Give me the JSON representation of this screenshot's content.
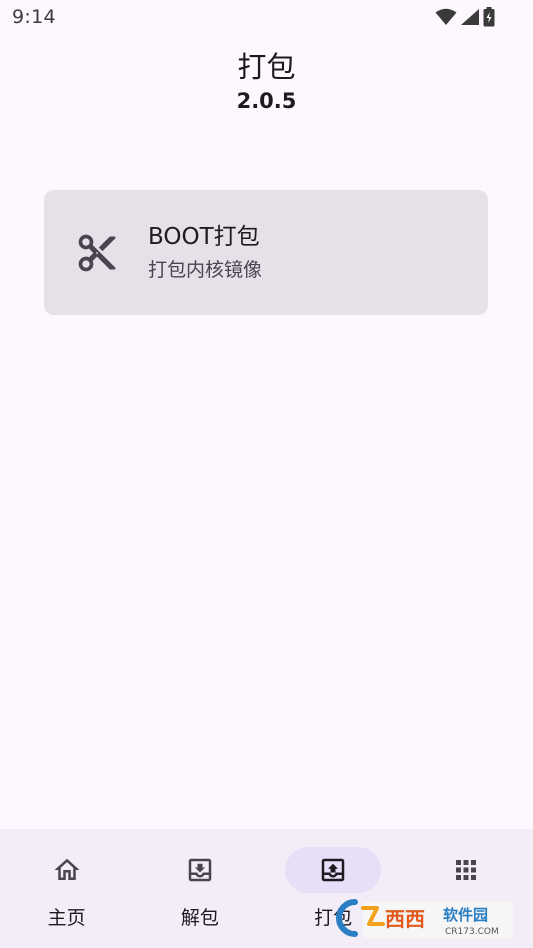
{
  "status_bar": {
    "time": "9:14",
    "icons": [
      "wifi-icon",
      "signal-icon",
      "battery-charging-icon"
    ]
  },
  "header": {
    "title": "打包",
    "version": "2.0.5"
  },
  "cards": [
    {
      "icon": "scissors-icon",
      "title": "BOOT打包",
      "subtitle": "打包内核镜像"
    }
  ],
  "bottom_nav": {
    "items": [
      {
        "icon": "home-icon",
        "label": "主页",
        "active": false
      },
      {
        "icon": "unpack-icon",
        "label": "解包",
        "active": false
      },
      {
        "icon": "pack-icon",
        "label": "打包",
        "active": true
      },
      {
        "icon": "apps-grid-icon",
        "label": "",
        "active": false
      }
    ]
  },
  "watermark": {
    "brand": "西西软件园",
    "domain": "CR173.COM"
  },
  "colors": {
    "background": "#FEF7FF",
    "card": "#E6E0E9",
    "nav_background": "#F3EDF7",
    "nav_indicator": "#E8DEF8",
    "icon": "#49454F",
    "text": "#1D1B20"
  }
}
